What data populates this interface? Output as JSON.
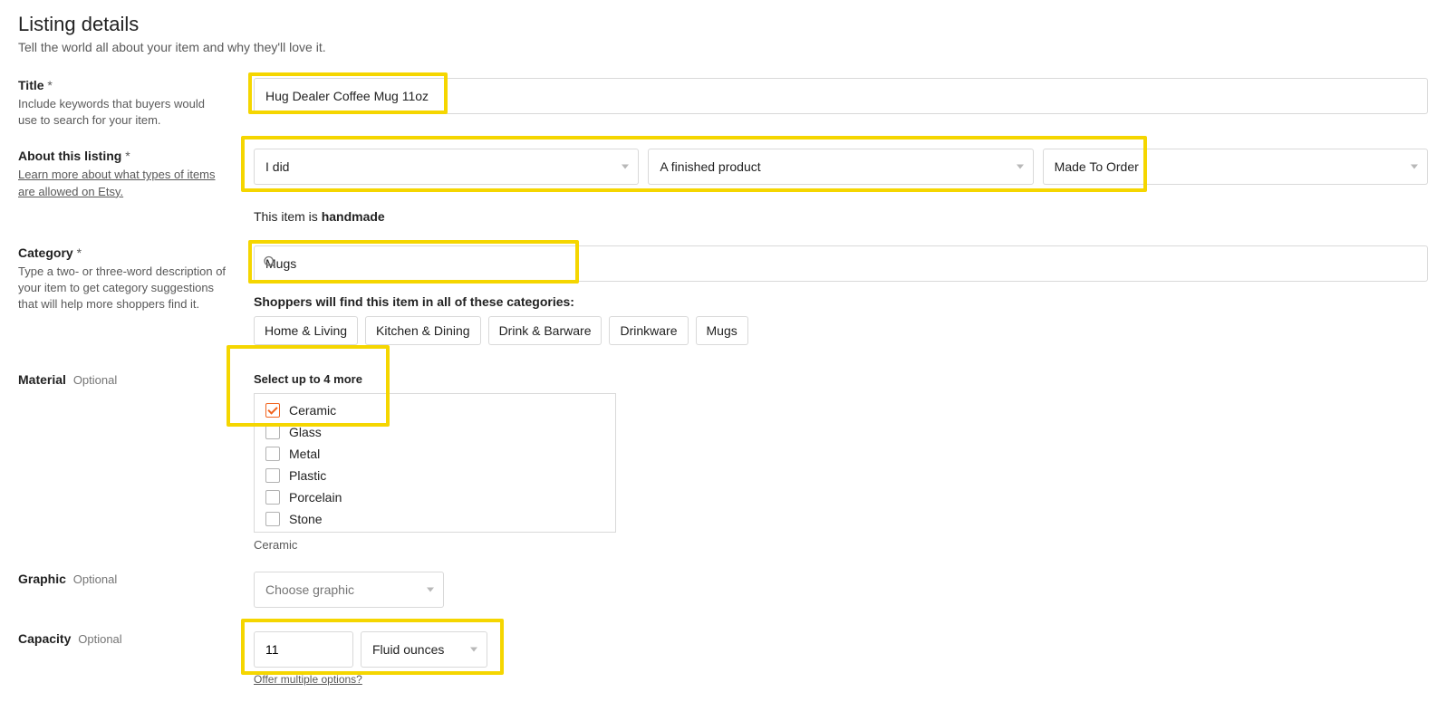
{
  "header": {
    "title": "Listing details",
    "subtitle": "Tell the world all about your item and why they'll love it."
  },
  "title_field": {
    "label": "Title",
    "help": "Include keywords that buyers would use to search for your item.",
    "value": "Hug Dealer Coffee Mug 11oz"
  },
  "about": {
    "label": "About this listing",
    "help_link": "Learn more about what types of items are allowed on Etsy.",
    "who": "I did",
    "what": "A finished product",
    "when": "Made To Order",
    "note_prefix": "This item is ",
    "note_strong": "handmade"
  },
  "category": {
    "label": "Category",
    "help": "Type a two- or three-word description of your item to get category suggestions that will help more shoppers find it.",
    "search_value": "Mugs",
    "find_note": "Shoppers will find this item in all of these categories:",
    "chips": [
      "Home & Living",
      "Kitchen & Dining",
      "Drink & Barware",
      "Drinkware",
      "Mugs"
    ]
  },
  "material": {
    "label": "Material",
    "optional": "Optional",
    "note": "Select up to 4 more",
    "options": [
      {
        "label": "Ceramic",
        "checked": true
      },
      {
        "label": "Glass",
        "checked": false
      },
      {
        "label": "Metal",
        "checked": false
      },
      {
        "label": "Plastic",
        "checked": false
      },
      {
        "label": "Porcelain",
        "checked": false
      },
      {
        "label": "Stone",
        "checked": false
      }
    ],
    "selected_summary": "Ceramic"
  },
  "graphic": {
    "label": "Graphic",
    "optional": "Optional",
    "placeholder": "Choose graphic"
  },
  "capacity": {
    "label": "Capacity",
    "optional": "Optional",
    "value": "11",
    "unit": "Fluid ounces",
    "offer_link": "Offer multiple options?"
  }
}
